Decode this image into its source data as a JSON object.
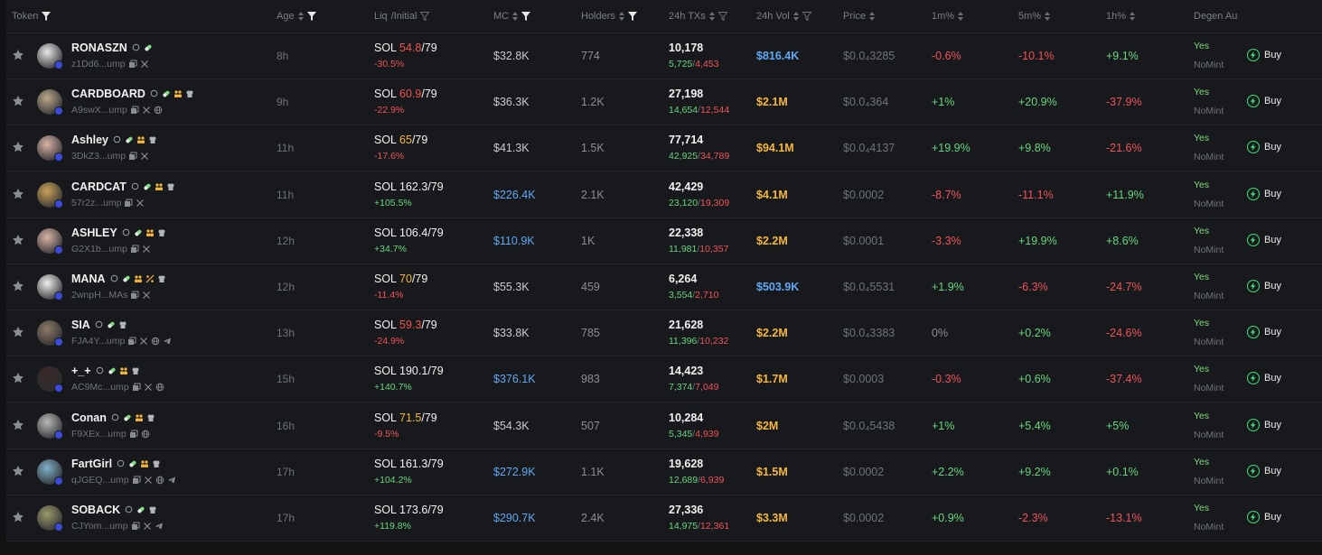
{
  "header": {
    "token": "Token",
    "age": "Age",
    "liq": "Liq",
    "initial": "/Initial",
    "mc": "MC",
    "holders": "Holders",
    "txs": "24h TXs",
    "vol": "24h Vol",
    "price": "Price",
    "m1": "1m%",
    "m5": "5m%",
    "h1": "1h%",
    "degen": "Degen Au"
  },
  "colors": {
    "background": "#18191c",
    "green": "#67d77e",
    "red": "#f0545a",
    "blue": "#5fa8f5",
    "yellow": "#f5b73b"
  },
  "rows": [
    {
      "name": "RONASZN",
      "addr": "z1Dd6...ump",
      "age": "8h",
      "liq_sol": "54.8",
      "liq_init": "/79",
      "liq_chg": "-30.5%",
      "liq_chg_dir": "down",
      "mc": "$32.8K",
      "mc_hi": false,
      "holders": "774",
      "txs": "10,178",
      "buys": "5,725",
      "sells": "4,453",
      "vol": "$816.4K",
      "vol_hi": true,
      "price": "$0.0₄3285",
      "m1": "-0.6%",
      "m1_dir": "down",
      "m5": "-10.1%",
      "m5_dir": "down",
      "h1": "+9.1%",
      "h1_dir": "up",
      "degen_yes": "Yes",
      "degen_nomint": "NoMint",
      "avatar_color": "#e8e8e8",
      "badges": [
        "search",
        "pill"
      ],
      "social": [
        "copy",
        "x"
      ]
    },
    {
      "name": "CARDBOARD",
      "addr": "A9swX...ump",
      "age": "9h",
      "liq_sol": "60.9",
      "liq_init": "/79",
      "liq_chg": "-22.9%",
      "liq_chg_dir": "down",
      "mc": "$36.3K",
      "mc_hi": false,
      "holders": "1.2K",
      "txs": "27,198",
      "buys": "14,654",
      "sells": "12,544",
      "vol": "$2.1M",
      "vol_hi": false,
      "price": "$0.0₄364",
      "m1": "+1%",
      "m1_dir": "up",
      "m5": "+20.9%",
      "m5_dir": "up",
      "h1": "-37.9%",
      "h1_dir": "down",
      "degen_yes": "Yes",
      "degen_nomint": "NoMint",
      "avatar_color": "#b8a88a",
      "badges": [
        "search",
        "pill",
        "people",
        "chef"
      ],
      "social": [
        "copy",
        "x",
        "globe"
      ]
    },
    {
      "name": "Ashley",
      "addr": "3DkZ3...ump",
      "age": "11h",
      "liq_sol": "65",
      "liq_init": "/79",
      "liq_chg": "-17.6%",
      "liq_chg_dir": "down",
      "mc": "$41.3K",
      "mc_hi": false,
      "holders": "1.5K",
      "txs": "77,714",
      "buys": "42,925",
      "sells": "34,789",
      "vol": "$94.1M",
      "vol_hi": false,
      "price": "$0.0₄4137",
      "m1": "+19.9%",
      "m1_dir": "up",
      "m5": "+9.8%",
      "m5_dir": "up",
      "h1": "-21.6%",
      "h1_dir": "down",
      "degen_yes": "Yes",
      "degen_nomint": "NoMint",
      "avatar_color": "#d9b4a6",
      "badges": [
        "search",
        "pill",
        "people",
        "chef"
      ],
      "social": [
        "copy",
        "x"
      ]
    },
    {
      "name": "CARDCAT",
      "addr": "57r2z...ump",
      "age": "11h",
      "liq_sol": "162.3",
      "liq_init": "/79",
      "liq_chg": "+105.5%",
      "liq_chg_dir": "up",
      "mc": "$226.4K",
      "mc_hi": true,
      "holders": "2.1K",
      "txs": "42,429",
      "buys": "23,120",
      "sells": "19,309",
      "vol": "$4.1M",
      "vol_hi": false,
      "price": "$0.0002",
      "m1": "-8.7%",
      "m1_dir": "down",
      "m5": "-11.1%",
      "m5_dir": "down",
      "h1": "+11.9%",
      "h1_dir": "up",
      "degen_yes": "Yes",
      "degen_nomint": "NoMint",
      "avatar_color": "#c9a35a",
      "badges": [
        "search",
        "pill",
        "people",
        "chef"
      ],
      "social": [
        "copy",
        "x"
      ]
    },
    {
      "name": "ASHLEY",
      "addr": "G2X1b...ump",
      "age": "12h",
      "liq_sol": "106.4",
      "liq_init": "/79",
      "liq_chg": "+34.7%",
      "liq_chg_dir": "up",
      "mc": "$110.9K",
      "mc_hi": true,
      "holders": "1K",
      "txs": "22,338",
      "buys": "11,981",
      "sells": "10,357",
      "vol": "$2.2M",
      "vol_hi": false,
      "price": "$0.0001",
      "m1": "-3.3%",
      "m1_dir": "down",
      "m5": "+19.9%",
      "m5_dir": "up",
      "h1": "+8.6%",
      "h1_dir": "up",
      "degen_yes": "Yes",
      "degen_nomint": "NoMint",
      "avatar_color": "#d9b4a6",
      "badges": [
        "search",
        "pill",
        "people",
        "chef"
      ],
      "social": [
        "copy",
        "x"
      ]
    },
    {
      "name": "MANA",
      "addr": "2wnpH...MAs",
      "age": "12h",
      "liq_sol": "70",
      "liq_init": "/79",
      "liq_chg": "-11.4%",
      "liq_chg_dir": "down",
      "mc": "$55.3K",
      "mc_hi": false,
      "holders": "459",
      "txs": "6,264",
      "buys": "3,554",
      "sells": "2,710",
      "vol": "$503.9K",
      "vol_hi": true,
      "price": "$0.0₄5531",
      "m1": "+1.9%",
      "m1_dir": "up",
      "m5": "-6.3%",
      "m5_dir": "down",
      "h1": "-24.7%",
      "h1_dir": "down",
      "degen_yes": "Yes",
      "degen_nomint": "NoMint",
      "avatar_color": "#f0f0f0",
      "badges": [
        "search",
        "pill",
        "people",
        "percent",
        "chef"
      ],
      "social": [
        "copy",
        "x"
      ]
    },
    {
      "name": "SIA",
      "addr": "FJA4Y...ump",
      "age": "13h",
      "liq_sol": "59.3",
      "liq_init": "/79",
      "liq_chg": "-24.9%",
      "liq_chg_dir": "down",
      "mc": "$33.8K",
      "mc_hi": false,
      "holders": "785",
      "txs": "21,628",
      "buys": "11,396",
      "sells": "10,232",
      "vol": "$2.2M",
      "vol_hi": false,
      "price": "$0.0₄3383",
      "m1": "0%",
      "m1_dir": "flat",
      "m5": "+0.2%",
      "m5_dir": "up",
      "h1": "-24.6%",
      "h1_dir": "down",
      "degen_yes": "Yes",
      "degen_nomint": "NoMint",
      "avatar_color": "#8c7a66",
      "badges": [
        "search",
        "pill",
        "chef"
      ],
      "social": [
        "copy",
        "x",
        "globe",
        "telegram"
      ]
    },
    {
      "name": "+_+",
      "addr": "AC9Mc...ump",
      "age": "15h",
      "liq_sol": "190.1",
      "liq_init": "/79",
      "liq_chg": "+140.7%",
      "liq_chg_dir": "up",
      "mc": "$376.1K",
      "mc_hi": true,
      "holders": "983",
      "txs": "14,423",
      "buys": "7,374",
      "sells": "7,049",
      "vol": "$1.7M",
      "vol_hi": false,
      "price": "$0.0003",
      "m1": "-0.3%",
      "m1_dir": "down",
      "m5": "+0.6%",
      "m5_dir": "up",
      "h1": "-37.4%",
      "h1_dir": "down",
      "degen_yes": "Yes",
      "degen_nomint": "NoMint",
      "avatar_color": "#3a2a26",
      "badges": [
        "search",
        "pill",
        "people",
        "chef"
      ],
      "social": [
        "copy",
        "x",
        "globe"
      ]
    },
    {
      "name": "Conan",
      "addr": "F9XEx...ump",
      "age": "16h",
      "liq_sol": "71.5",
      "liq_init": "/79",
      "liq_chg": "-9.5%",
      "liq_chg_dir": "down",
      "mc": "$54.3K",
      "mc_hi": false,
      "holders": "507",
      "txs": "10,284",
      "buys": "5,345",
      "sells": "4,939",
      "vol": "$2M",
      "vol_hi": false,
      "price": "$0.0₄5438",
      "m1": "+1%",
      "m1_dir": "up",
      "m5": "+5.4%",
      "m5_dir": "up",
      "h1": "+5%",
      "h1_dir": "up",
      "degen_yes": "Yes",
      "degen_nomint": "NoMint",
      "avatar_color": "#b9b9b9",
      "badges": [
        "search",
        "pill",
        "people",
        "chef"
      ],
      "social": [
        "copy",
        "globe"
      ]
    },
    {
      "name": "FartGirl",
      "addr": "qJGEQ...ump",
      "age": "17h",
      "liq_sol": "161.3",
      "liq_init": "/79",
      "liq_chg": "+104.2%",
      "liq_chg_dir": "up",
      "mc": "$272.9K",
      "mc_hi": true,
      "holders": "1.1K",
      "txs": "19,628",
      "buys": "12,689",
      "sells": "6,939",
      "vol": "$1.5M",
      "vol_hi": false,
      "price": "$0.0002",
      "m1": "+2.2%",
      "m1_dir": "up",
      "m5": "+9.2%",
      "m5_dir": "up",
      "h1": "+0.1%",
      "h1_dir": "up",
      "degen_yes": "Yes",
      "degen_nomint": "NoMint",
      "avatar_color": "#7fb0c8",
      "badges": [
        "search",
        "pill",
        "people",
        "chef"
      ],
      "social": [
        "copy",
        "x",
        "globe",
        "telegram"
      ]
    },
    {
      "name": "SOBACK",
      "addr": "CJYom...ump",
      "age": "17h",
      "liq_sol": "173.6",
      "liq_init": "/79",
      "liq_chg": "+119.8%",
      "liq_chg_dir": "up",
      "mc": "$290.7K",
      "mc_hi": true,
      "holders": "2.4K",
      "txs": "27,336",
      "buys": "14,975",
      "sells": "12,361",
      "vol": "$3.3M",
      "vol_hi": false,
      "price": "$0.0002",
      "m1": "+0.9%",
      "m1_dir": "up",
      "m5": "-2.3%",
      "m5_dir": "down",
      "h1": "-13.1%",
      "h1_dir": "down",
      "degen_yes": "Yes",
      "degen_nomint": "NoMint",
      "avatar_color": "#9a9a6a",
      "badges": [
        "search",
        "pill",
        "chef"
      ],
      "social": [
        "copy",
        "x",
        "telegram"
      ]
    }
  ],
  "buy_label": "Buy",
  "sol_label": "SOL "
}
